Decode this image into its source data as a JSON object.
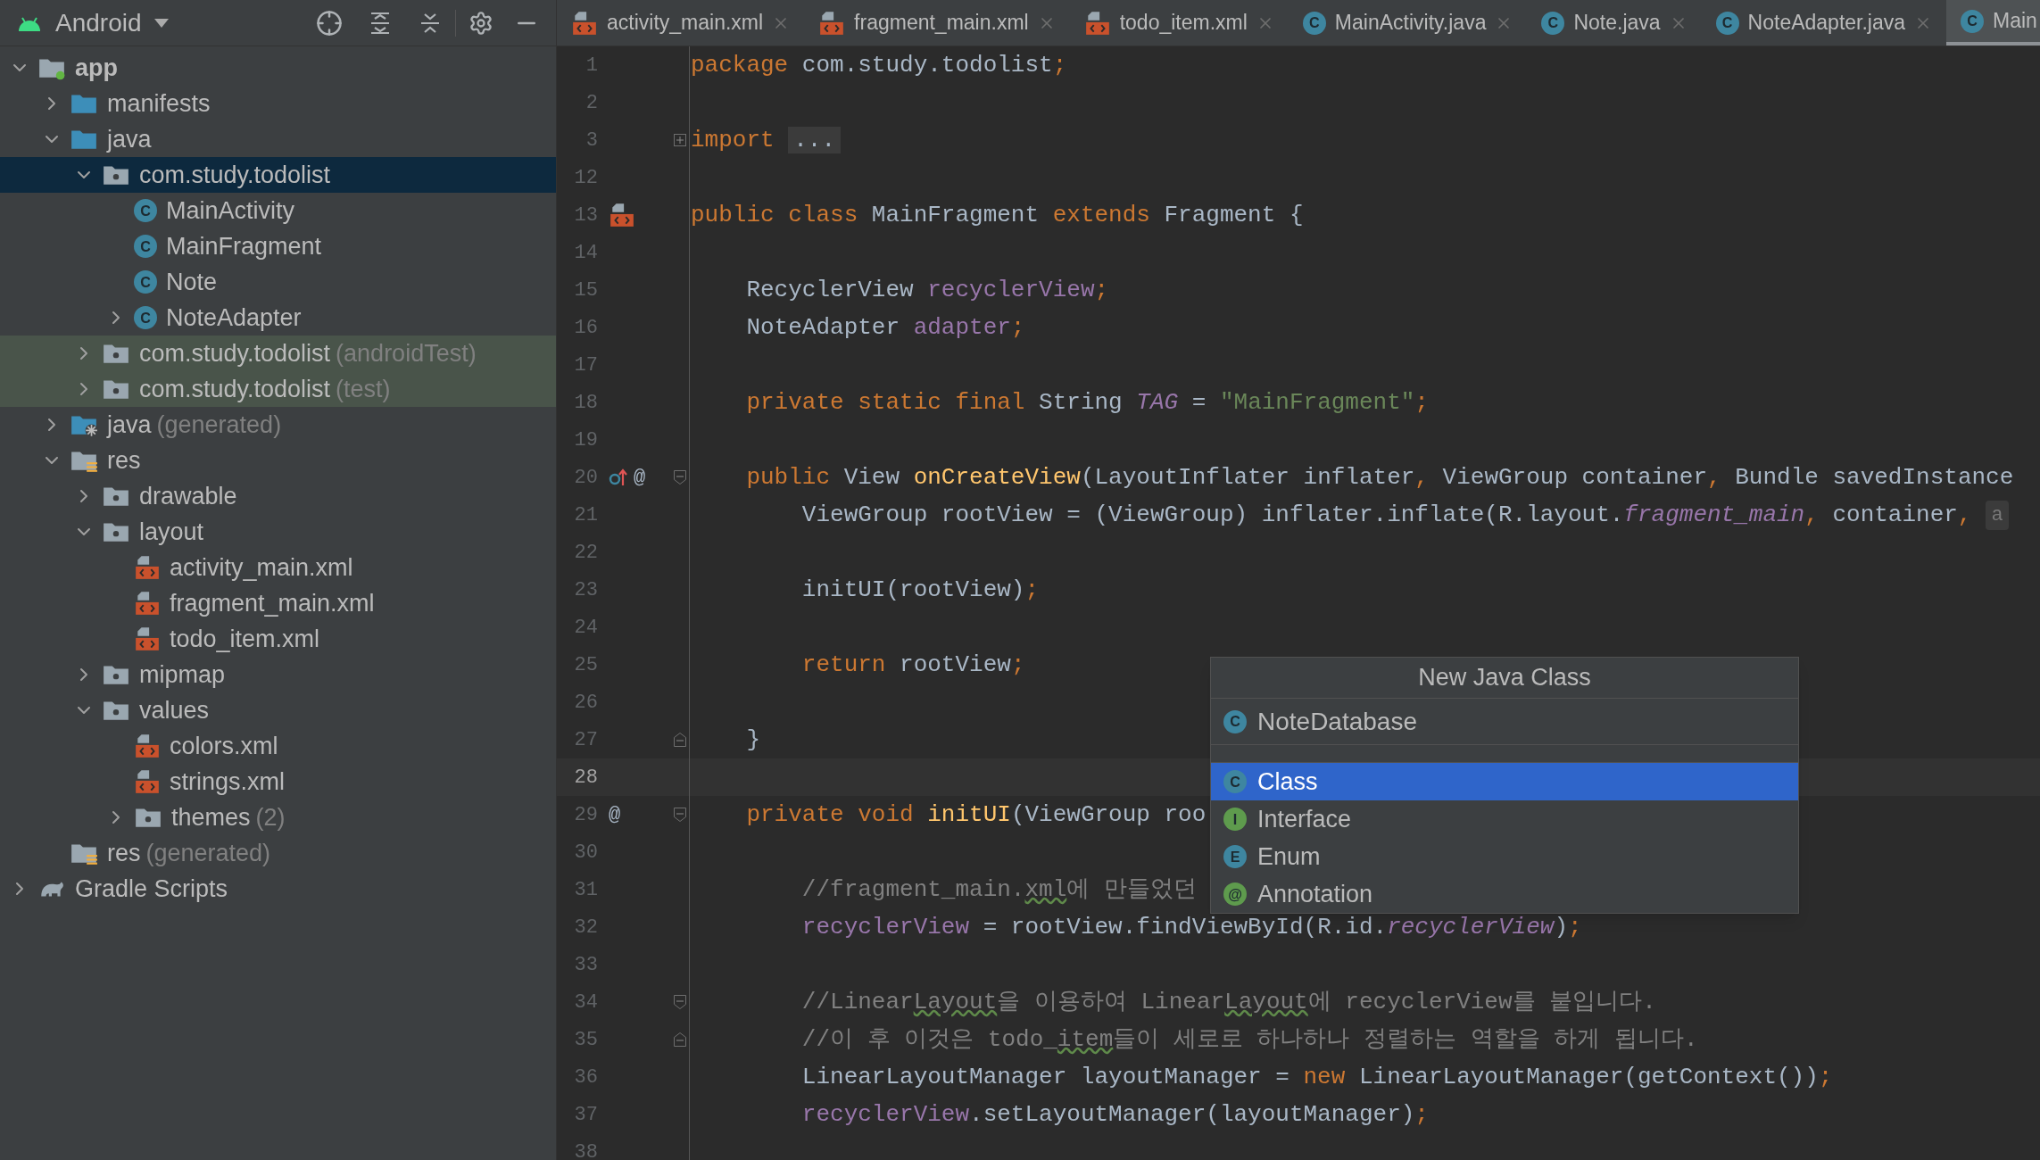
{
  "project_panel": {
    "view": "Android",
    "tree": [
      {
        "label": "app",
        "kind": "module",
        "expanded": true,
        "selected": false,
        "highlighted": false,
        "children": [
          {
            "label": "manifests",
            "kind": "folder",
            "expanded": false,
            "selected": false,
            "highlighted": false
          },
          {
            "label": "java",
            "kind": "folder",
            "expanded": true,
            "selected": false,
            "highlighted": false,
            "children": [
              {
                "label": "com.study.todolist",
                "kind": "package",
                "expanded": true,
                "selected": true,
                "highlighted": false,
                "children": [
                  {
                    "label": "MainActivity",
                    "kind": "class",
                    "badge": "C",
                    "selected": false,
                    "highlighted": false
                  },
                  {
                    "label": "MainFragment",
                    "kind": "class",
                    "badge": "C",
                    "selected": false,
                    "highlighted": false
                  },
                  {
                    "label": "Note",
                    "kind": "class",
                    "badge": "C",
                    "selected": false,
                    "highlighted": false
                  },
                  {
                    "label": "NoteAdapter",
                    "kind": "class",
                    "badge": "C",
                    "expanded": false,
                    "selected": false,
                    "highlighted": false
                  }
                ]
              },
              {
                "label": "com.study.todolist",
                "note": "(androidTest)",
                "kind": "package",
                "expanded": false,
                "selected": false,
                "highlighted": true
              },
              {
                "label": "com.study.todolist",
                "note": "(test)",
                "kind": "package",
                "expanded": false,
                "selected": false,
                "highlighted": true
              }
            ]
          },
          {
            "label": "java",
            "note": "(generated)",
            "kind": "generated",
            "expanded": false,
            "selected": false,
            "highlighted": false
          },
          {
            "label": "res",
            "kind": "res",
            "expanded": true,
            "selected": false,
            "highlighted": false,
            "children": [
              {
                "label": "drawable",
                "kind": "package",
                "expanded": false,
                "selected": false,
                "highlighted": false
              },
              {
                "label": "layout",
                "kind": "package",
                "expanded": true,
                "selected": false,
                "highlighted": false,
                "children": [
                  {
                    "label": "activity_main.xml",
                    "kind": "xml",
                    "selected": false,
                    "highlighted": false
                  },
                  {
                    "label": "fragment_main.xml",
                    "kind": "xml",
                    "selected": false,
                    "highlighted": false
                  },
                  {
                    "label": "todo_item.xml",
                    "kind": "xml",
                    "selected": false,
                    "highlighted": false
                  }
                ]
              },
              {
                "label": "mipmap",
                "kind": "package",
                "expanded": false,
                "selected": false,
                "highlighted": false
              },
              {
                "label": "values",
                "kind": "package",
                "expanded": true,
                "selected": false,
                "highlighted": false,
                "children": [
                  {
                    "label": "colors.xml",
                    "kind": "xml",
                    "selected": false,
                    "highlighted": false
                  },
                  {
                    "label": "strings.xml",
                    "kind": "xml",
                    "selected": false,
                    "highlighted": false
                  },
                  {
                    "label": "themes",
                    "note": "(2)",
                    "kind": "package",
                    "expanded": false,
                    "selected": false,
                    "highlighted": false
                  }
                ]
              }
            ]
          },
          {
            "label": "res",
            "note": "(generated)",
            "kind": "res",
            "selected": false,
            "highlighted": false
          }
        ]
      },
      {
        "label": "Gradle Scripts",
        "kind": "gradle",
        "expanded": false,
        "selected": false,
        "highlighted": false
      }
    ]
  },
  "tabs": [
    {
      "label": "activity_main.xml",
      "kind": "xml",
      "selected": false,
      "cut": false
    },
    {
      "label": "fragment_main.xml",
      "kind": "xml",
      "selected": false,
      "cut": false
    },
    {
      "label": "todo_item.xml",
      "kind": "xml",
      "selected": false,
      "cut": false
    },
    {
      "label": "MainActivity.java",
      "kind": "class",
      "badge": "C",
      "selected": false,
      "cut": false
    },
    {
      "label": "Note.java",
      "kind": "class",
      "badge": "C",
      "selected": false,
      "cut": false
    },
    {
      "label": "NoteAdapter.java",
      "kind": "class",
      "badge": "C",
      "selected": false,
      "cut": false
    },
    {
      "label": "Main",
      "kind": "class",
      "badge": "C",
      "selected": true,
      "cut": true
    }
  ],
  "editor": {
    "lines": [
      {
        "number": "1",
        "current": false,
        "tokens": [
          {
            "kind": "keyword",
            "text": "package"
          },
          {
            "kind": "plain",
            "text": " com.study.todolist"
          },
          {
            "kind": "keyword",
            "text": ";"
          }
        ]
      },
      {
        "number": "2",
        "current": false
      },
      {
        "number": "3",
        "current": false,
        "gutter": [
          {
            "kind": "fold-collapsed"
          }
        ],
        "tokens": [
          {
            "kind": "keyword",
            "text": "import "
          },
          {
            "kind": "folded",
            "text": "..."
          }
        ]
      },
      {
        "number": "12",
        "current": false
      },
      {
        "number": "13",
        "current": false,
        "gutter": [
          {
            "kind": "xml-file"
          }
        ],
        "tokens": [
          {
            "kind": "keyword",
            "text": "public class"
          },
          {
            "kind": "plain",
            "text": " MainFragment "
          },
          {
            "kind": "keyword",
            "text": "extends"
          },
          {
            "kind": "plain",
            "text": " Fragment {"
          }
        ]
      },
      {
        "number": "14",
        "current": false
      },
      {
        "number": "15",
        "current": false,
        "tokens": [
          {
            "kind": "plain",
            "text": "    RecyclerView "
          },
          {
            "kind": "field",
            "text": "recyclerView"
          },
          {
            "kind": "keyword",
            "text": ";"
          }
        ]
      },
      {
        "number": "16",
        "current": false,
        "tokens": [
          {
            "kind": "plain",
            "text": "    NoteAdapter "
          },
          {
            "kind": "field",
            "text": "adapter"
          },
          {
            "kind": "keyword",
            "text": ";"
          }
        ]
      },
      {
        "number": "17",
        "current": false
      },
      {
        "number": "18",
        "current": false,
        "tokens": [
          {
            "kind": "keyword",
            "text": "    private static final"
          },
          {
            "kind": "plain",
            "text": " String "
          },
          {
            "kind": "constant",
            "text": "TAG"
          },
          {
            "kind": "plain",
            "text": " = "
          },
          {
            "kind": "string",
            "text": "\"MainFragment\""
          },
          {
            "kind": "keyword",
            "text": ";"
          }
        ]
      },
      {
        "number": "19",
        "current": false
      },
      {
        "number": "20",
        "current": false,
        "gutter": [
          {
            "kind": "override"
          },
          {
            "kind": "text",
            "text": "@"
          },
          {
            "kind": "fold-start"
          }
        ],
        "tokens": [
          {
            "kind": "keyword",
            "text": "    public"
          },
          {
            "kind": "plain",
            "text": " View "
          },
          {
            "kind": "method",
            "text": "onCreateView"
          },
          {
            "kind": "plain",
            "text": "(LayoutInflater inflater"
          },
          {
            "kind": "keyword",
            "text": ","
          },
          {
            "kind": "plain",
            "text": " ViewGroup container"
          },
          {
            "kind": "keyword",
            "text": ","
          },
          {
            "kind": "plain",
            "text": " Bundle savedInstance"
          }
        ]
      },
      {
        "number": "21",
        "current": false,
        "hint": "a",
        "tokens": [
          {
            "kind": "plain",
            "text": "        ViewGroup rootView = (ViewGroup) inflater.inflate(R.layout."
          },
          {
            "kind": "static",
            "text": "fragment_main"
          },
          {
            "kind": "keyword",
            "text": ","
          },
          {
            "kind": "plain",
            "text": " container"
          },
          {
            "kind": "keyword",
            "text": ","
          }
        ]
      },
      {
        "number": "22",
        "current": false
      },
      {
        "number": "23",
        "current": false,
        "tokens": [
          {
            "kind": "plain",
            "text": "        initUI(rootView)"
          },
          {
            "kind": "keyword",
            "text": ";"
          }
        ]
      },
      {
        "number": "24",
        "current": false
      },
      {
        "number": "25",
        "current": false,
        "tokens": [
          {
            "kind": "keyword",
            "text": "        return"
          },
          {
            "kind": "plain",
            "text": " rootView"
          },
          {
            "kind": "keyword",
            "text": ";"
          }
        ]
      },
      {
        "number": "26",
        "current": false
      },
      {
        "number": "27",
        "current": false,
        "gutter": [
          {
            "kind": "fold-end"
          }
        ],
        "tokens": [
          {
            "kind": "plain",
            "text": "    }"
          }
        ]
      },
      {
        "number": "28",
        "current": true
      },
      {
        "number": "29",
        "current": false,
        "gutter": [
          {
            "kind": "text",
            "text": "@"
          },
          {
            "kind": "fold-start"
          }
        ],
        "tokens": [
          {
            "kind": "keyword",
            "text": "    private void "
          },
          {
            "kind": "method",
            "text": "initUI"
          },
          {
            "kind": "plain",
            "text": "(ViewGroup roo"
          }
        ]
      },
      {
        "number": "30",
        "current": false
      },
      {
        "number": "31",
        "current": false,
        "tokens": [
          {
            "kind": "comment",
            "text": "        //fragment_main."
          },
          {
            "kind": "typo",
            "text": "xml"
          },
          {
            "kind": "comment",
            "text": "에 만들었던"
          }
        ]
      },
      {
        "number": "32",
        "current": false,
        "tokens": [
          {
            "kind": "field",
            "text": "        recyclerView"
          },
          {
            "kind": "plain",
            "text": " = rootView.findViewById(R.id."
          },
          {
            "kind": "static",
            "text": "recyclerView"
          },
          {
            "kind": "plain",
            "text": ")"
          },
          {
            "kind": "keyword",
            "text": ";"
          }
        ]
      },
      {
        "number": "33",
        "current": false
      },
      {
        "number": "34",
        "current": false,
        "gutter": [
          {
            "kind": "fold-start"
          }
        ],
        "tokens": [
          {
            "kind": "comment",
            "text": "        //Linear"
          },
          {
            "kind": "typo",
            "text": "Layout"
          },
          {
            "kind": "comment",
            "text": "을 이용하여 Linear"
          },
          {
            "kind": "typo",
            "text": "Layout"
          },
          {
            "kind": "comment",
            "text": "에 recyclerView를 붙입니다."
          }
        ]
      },
      {
        "number": "35",
        "current": false,
        "gutter": [
          {
            "kind": "fold-end"
          }
        ],
        "tokens": [
          {
            "kind": "comment",
            "text": "        //이 후 이것은 todo_"
          },
          {
            "kind": "typo",
            "text": "item"
          },
          {
            "kind": "comment",
            "text": "들이 세로로 하나하나 정렬하는 역할을 하게 됩니다."
          }
        ]
      },
      {
        "number": "36",
        "current": false,
        "tokens": [
          {
            "kind": "plain",
            "text": "        LinearLayoutManager layoutManager = "
          },
          {
            "kind": "keyword",
            "text": "new"
          },
          {
            "kind": "plain",
            "text": " LinearLayoutManager(getContext())"
          },
          {
            "kind": "keyword",
            "text": ";"
          }
        ]
      },
      {
        "number": "37",
        "current": false,
        "tokens": [
          {
            "kind": "field",
            "text": "        recyclerView"
          },
          {
            "kind": "plain",
            "text": ".setLayoutManager(layoutManager)"
          },
          {
            "kind": "keyword",
            "text": ";"
          }
        ]
      },
      {
        "number": "38",
        "current": false
      }
    ]
  },
  "new_class_popup": {
    "title": "New Java Class",
    "name_field": {
      "value": "NoteDatabase",
      "badge": "C"
    },
    "kinds": [
      {
        "label": "Class",
        "badge": "C",
        "color": "#3e86a0",
        "selected": true
      },
      {
        "label": "Interface",
        "badge": "I",
        "color": "#5e9b4d",
        "selected": false
      },
      {
        "label": "Enum",
        "badge": "E",
        "color": "#3e86a0",
        "selected": false
      },
      {
        "label": "Annotation",
        "badge": "@",
        "color": "#5e9b4d",
        "selected": false
      }
    ]
  }
}
